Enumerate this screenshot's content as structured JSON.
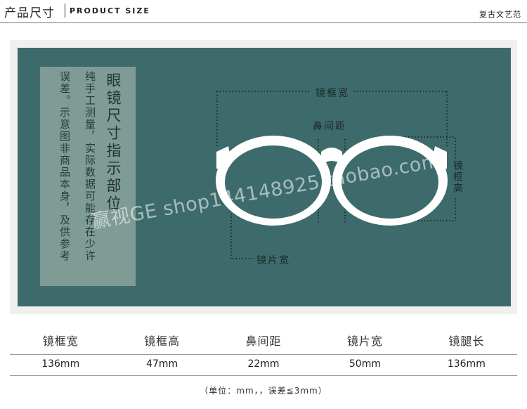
{
  "header": {
    "title": "产品尺寸",
    "subtitle": "PRODUCT SIZE",
    "brand": "复古文艺范"
  },
  "figure": {
    "note_columns": [
      "眼镜尺寸指示部位",
      "纯手工测量，实际数据可能存在少许",
      "误差。示意图非商品本身，及供参考"
    ],
    "labels": {
      "frame_width": "镜框宽",
      "bridge": "鼻间距",
      "frame_height": "镜框高",
      "lens_width": "镜片宽"
    },
    "watermark": "赢视GE shop144148925.taobao.com",
    "colors": {
      "panel": "#3d6b6b",
      "note_box": "#7e9b95",
      "glasses": "#ffffff"
    }
  },
  "table": {
    "headers": [
      "镜框宽",
      "镜框高",
      "鼻间距",
      "镜片宽",
      "镜腿长"
    ],
    "values": [
      "136mm",
      "47mm",
      "22mm",
      "50mm",
      "136mm"
    ]
  },
  "footnote": "（单位：mm，，误差≦3mm）"
}
